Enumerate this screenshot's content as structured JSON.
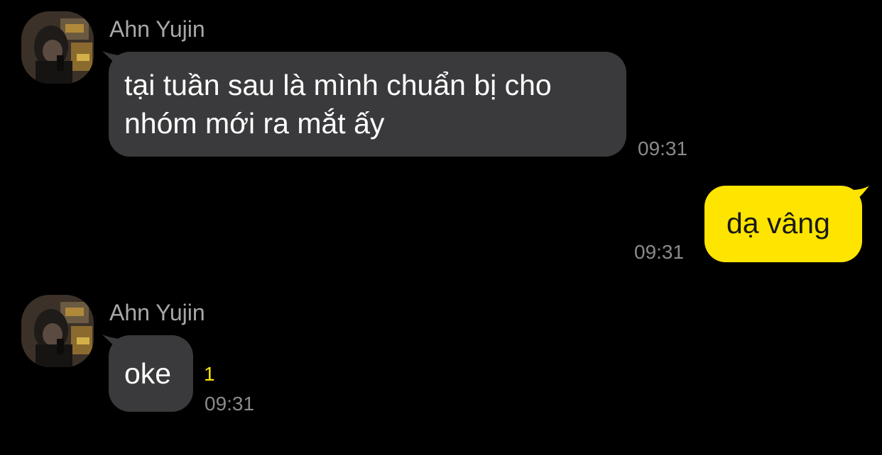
{
  "colors": {
    "background": "#000000",
    "incoming_bubble": "#3a3a3c",
    "outgoing_bubble": "#fee500",
    "unread_badge": "#fee500",
    "timestamp": "#8a8a8a",
    "sender_name": "#a8a8a8"
  },
  "messages": [
    {
      "direction": "incoming",
      "sender": "Ahn Yujin",
      "avatar": "user-avatar",
      "text": "tại tuần sau là mình chuẩn bị cho nhóm mới ra mắt ấy",
      "time": "09:31"
    },
    {
      "direction": "outgoing",
      "text": "dạ vâng",
      "time": "09:31"
    },
    {
      "direction": "incoming",
      "sender": "Ahn Yujin",
      "avatar": "user-avatar",
      "text": "oke",
      "unread": "1",
      "time": "09:31"
    }
  ]
}
